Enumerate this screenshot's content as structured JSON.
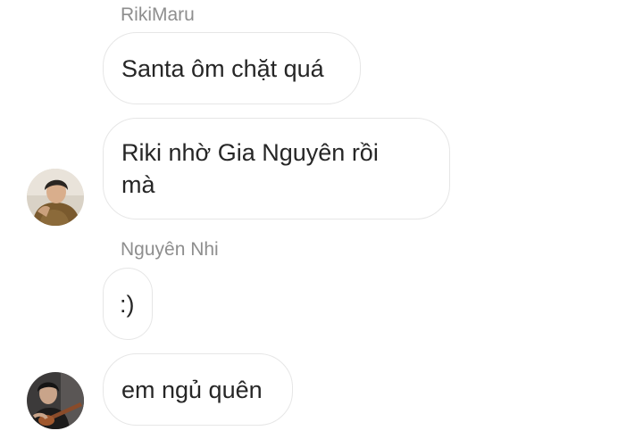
{
  "messages": [
    {
      "sender": "RikiMaru",
      "text": "Santa ôm chặt quá"
    },
    {
      "text": "Riki nhờ Gia Nguyên rồi mà"
    },
    {
      "sender": "Nguyên Nhi",
      "text": ":)"
    },
    {
      "text": "em ngủ quên"
    }
  ],
  "avatars": [
    {
      "icon": "user-avatar-photo-1"
    },
    {
      "icon": "user-avatar-photo-2"
    }
  ],
  "colors": {
    "bubble_border": "#e6e6e6",
    "text": "#262626",
    "sender_name": "#8e8e8e",
    "background": "#ffffff"
  }
}
